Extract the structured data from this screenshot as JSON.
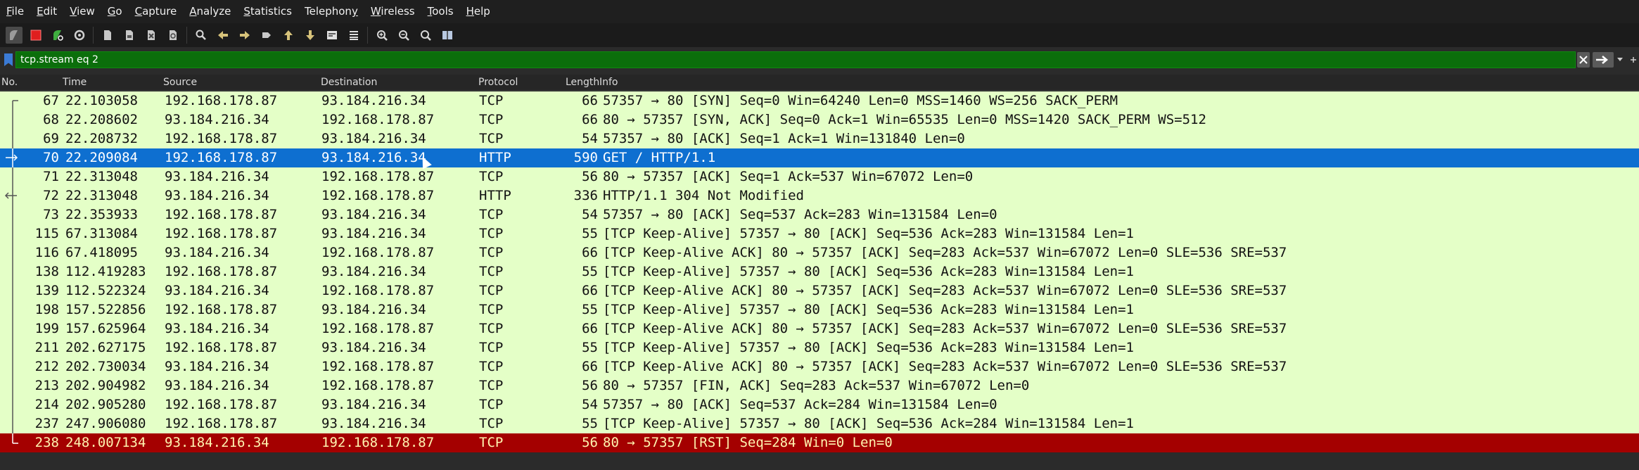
{
  "menu": [
    {
      "label": "File",
      "ul": "F",
      "rest": "ile"
    },
    {
      "label": "Edit",
      "ul": "E",
      "rest": "dit"
    },
    {
      "label": "View",
      "ul": "V",
      "rest": "iew"
    },
    {
      "label": "Go",
      "ul": "G",
      "rest": "o"
    },
    {
      "label": "Capture",
      "ul": "C",
      "rest": "apture"
    },
    {
      "label": "Analyze",
      "ul": "A",
      "rest": "nalyze"
    },
    {
      "label": "Statistics",
      "ul": "S",
      "rest": "tatistics"
    },
    {
      "label": "Telephony",
      "ul": "y",
      "pre": "Telephon",
      "rest": ""
    },
    {
      "label": "Wireless",
      "ul": "W",
      "rest": "ireless"
    },
    {
      "label": "Tools",
      "ul": "T",
      "rest": "ools"
    },
    {
      "label": "Help",
      "ul": "H",
      "rest": "elp"
    }
  ],
  "filter": {
    "value": "tcp.stream eq 2"
  },
  "columns": {
    "no": "No.",
    "time": "Time",
    "source": "Source",
    "destination": "Destination",
    "protocol": "Protocol",
    "length": "Length",
    "info": "Info"
  },
  "colors": {
    "tcp_row": "#e4ffc7",
    "selected_row": "#0e6fd0",
    "rst_row": "#a40000",
    "filter_ok": "#0b6e0b"
  },
  "packets": [
    {
      "no": "67",
      "time": "22.103058",
      "src": "192.168.178.87",
      "dst": "93.184.216.34",
      "proto": "TCP",
      "len": "66",
      "info": "57357 → 80 [SYN] Seq=0 Win=64240 Len=0 MSS=1460 WS=256 SACK_PERM",
      "style": "normal",
      "tree": "start"
    },
    {
      "no": "68",
      "time": "22.208602",
      "src": "93.184.216.34",
      "dst": "192.168.178.87",
      "proto": "TCP",
      "len": "66",
      "info": "80 → 57357 [SYN, ACK] Seq=0 Ack=1 Win=65535 Len=0 MSS=1420 SACK_PERM WS=512",
      "style": "normal",
      "tree": "mid"
    },
    {
      "no": "69",
      "time": "22.208732",
      "src": "192.168.178.87",
      "dst": "93.184.216.34",
      "proto": "TCP",
      "len": "54",
      "info": "57357 → 80 [ACK] Seq=1 Ack=1 Win=131840 Len=0",
      "style": "normal",
      "tree": "mid"
    },
    {
      "no": "70",
      "time": "22.209084",
      "src": "192.168.178.87",
      "dst": "93.184.216.34",
      "proto": "HTTP",
      "len": "590",
      "info": "GET / HTTP/1.1",
      "style": "selected",
      "tree": "request"
    },
    {
      "no": "71",
      "time": "22.313048",
      "src": "93.184.216.34",
      "dst": "192.168.178.87",
      "proto": "TCP",
      "len": "56",
      "info": "80 → 57357 [ACK] Seq=1 Ack=537 Win=67072 Len=0",
      "style": "normal",
      "tree": "mid"
    },
    {
      "no": "72",
      "time": "22.313048",
      "src": "93.184.216.34",
      "dst": "192.168.178.87",
      "proto": "HTTP",
      "len": "336",
      "info": "HTTP/1.1 304 Not Modified",
      "style": "normal",
      "tree": "response"
    },
    {
      "no": "73",
      "time": "22.353933",
      "src": "192.168.178.87",
      "dst": "93.184.216.34",
      "proto": "TCP",
      "len": "54",
      "info": "57357 → 80 [ACK] Seq=537 Ack=283 Win=131584 Len=0",
      "style": "normal",
      "tree": "mid"
    },
    {
      "no": "115",
      "time": "67.313084",
      "src": "192.168.178.87",
      "dst": "93.184.216.34",
      "proto": "TCP",
      "len": "55",
      "info": "[TCP Keep-Alive] 57357 → 80 [ACK] Seq=536 Ack=283 Win=131584 Len=1",
      "style": "normal",
      "tree": "mid"
    },
    {
      "no": "116",
      "time": "67.418095",
      "src": "93.184.216.34",
      "dst": "192.168.178.87",
      "proto": "TCP",
      "len": "66",
      "info": "[TCP Keep-Alive ACK] 80 → 57357 [ACK] Seq=283 Ack=537 Win=67072 Len=0 SLE=536 SRE=537",
      "style": "normal",
      "tree": "mid"
    },
    {
      "no": "138",
      "time": "112.419283",
      "src": "192.168.178.87",
      "dst": "93.184.216.34",
      "proto": "TCP",
      "len": "55",
      "info": "[TCP Keep-Alive] 57357 → 80 [ACK] Seq=536 Ack=283 Win=131584 Len=1",
      "style": "normal",
      "tree": "mid"
    },
    {
      "no": "139",
      "time": "112.522324",
      "src": "93.184.216.34",
      "dst": "192.168.178.87",
      "proto": "TCP",
      "len": "66",
      "info": "[TCP Keep-Alive ACK] 80 → 57357 [ACK] Seq=283 Ack=537 Win=67072 Len=0 SLE=536 SRE=537",
      "style": "normal",
      "tree": "mid"
    },
    {
      "no": "198",
      "time": "157.522856",
      "src": "192.168.178.87",
      "dst": "93.184.216.34",
      "proto": "TCP",
      "len": "55",
      "info": "[TCP Keep-Alive] 57357 → 80 [ACK] Seq=536 Ack=283 Win=131584 Len=1",
      "style": "normal",
      "tree": "mid"
    },
    {
      "no": "199",
      "time": "157.625964",
      "src": "93.184.216.34",
      "dst": "192.168.178.87",
      "proto": "TCP",
      "len": "66",
      "info": "[TCP Keep-Alive ACK] 80 → 57357 [ACK] Seq=283 Ack=537 Win=67072 Len=0 SLE=536 SRE=537",
      "style": "normal",
      "tree": "mid"
    },
    {
      "no": "211",
      "time": "202.627175",
      "src": "192.168.178.87",
      "dst": "93.184.216.34",
      "proto": "TCP",
      "len": "55",
      "info": "[TCP Keep-Alive] 57357 → 80 [ACK] Seq=536 Ack=283 Win=131584 Len=1",
      "style": "normal",
      "tree": "mid"
    },
    {
      "no": "212",
      "time": "202.730034",
      "src": "93.184.216.34",
      "dst": "192.168.178.87",
      "proto": "TCP",
      "len": "66",
      "info": "[TCP Keep-Alive ACK] 80 → 57357 [ACK] Seq=283 Ack=537 Win=67072 Len=0 SLE=536 SRE=537",
      "style": "normal",
      "tree": "mid"
    },
    {
      "no": "213",
      "time": "202.904982",
      "src": "93.184.216.34",
      "dst": "192.168.178.87",
      "proto": "TCP",
      "len": "56",
      "info": "80 → 57357 [FIN, ACK] Seq=283 Ack=537 Win=67072 Len=0",
      "style": "normal",
      "tree": "mid"
    },
    {
      "no": "214",
      "time": "202.905280",
      "src": "192.168.178.87",
      "dst": "93.184.216.34",
      "proto": "TCP",
      "len": "54",
      "info": "57357 → 80 [ACK] Seq=537 Ack=284 Win=131584 Len=0",
      "style": "normal",
      "tree": "mid"
    },
    {
      "no": "237",
      "time": "247.906080",
      "src": "192.168.178.87",
      "dst": "93.184.216.34",
      "proto": "TCP",
      "len": "55",
      "info": "[TCP Keep-Alive] 57357 → 80 [ACK] Seq=536 Ack=284 Win=131584 Len=1",
      "style": "normal",
      "tree": "mid"
    },
    {
      "no": "238",
      "time": "248.007134",
      "src": "93.184.216.34",
      "dst": "192.168.178.87",
      "proto": "TCP",
      "len": "56",
      "info": "80 → 57357 [RST] Seq=284 Win=0 Len=0",
      "style": "rst",
      "tree": "end"
    }
  ]
}
